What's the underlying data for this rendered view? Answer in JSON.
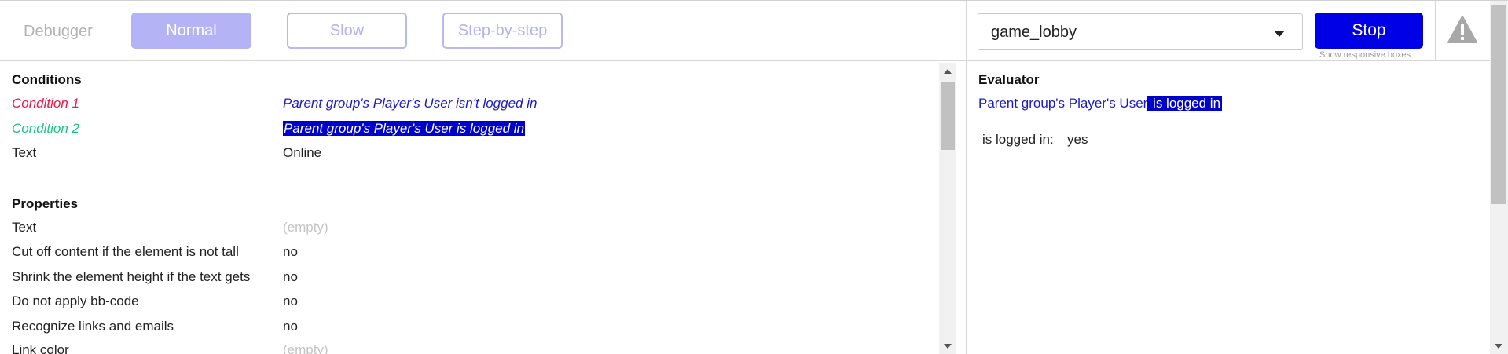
{
  "toolbar": {
    "debugger_label": "Debugger",
    "modes": [
      {
        "label": "Normal",
        "active": true
      },
      {
        "label": "Slow",
        "active": false
      },
      {
        "label": "Step-by-step",
        "active": false
      }
    ],
    "page_select": {
      "value": "game_lobby"
    },
    "stop_label": "Stop",
    "responsive_boxes_label": "Show responsive boxes",
    "warning_icon": "warning-triangle-icon"
  },
  "inspector": {
    "conditions_title": "Conditions",
    "conditions": [
      {
        "label": "Condition 1",
        "value": "Parent group's Player's User isn't logged in"
      },
      {
        "label": "Condition 2",
        "value": "Parent group's Player's User is logged in"
      },
      {
        "label": "Text",
        "value": "Online"
      }
    ],
    "properties_title": "Properties",
    "properties": [
      {
        "label": "Text",
        "value": "(empty)"
      },
      {
        "label": "Cut off content if the element is not tall",
        "value": "no"
      },
      {
        "label": "Shrink the element height if the text gets",
        "value": "no"
      },
      {
        "label": "Do not apply bb-code",
        "value": "no"
      },
      {
        "label": "Recognize links and emails",
        "value": "no"
      },
      {
        "label": "Link color",
        "value": "(empty)"
      }
    ]
  },
  "evaluator": {
    "title": "Evaluator",
    "expression_prefix": "Parent group's Player's User",
    "expression_selected": " is logged in",
    "result_label": "is logged in:",
    "result_value": "yes"
  },
  "colors": {
    "accent": "#0000e6",
    "condition_1": "#e8194a",
    "condition_2": "#19c486",
    "expression": "#1a1acc",
    "mode_active": "#b3b3f5"
  }
}
